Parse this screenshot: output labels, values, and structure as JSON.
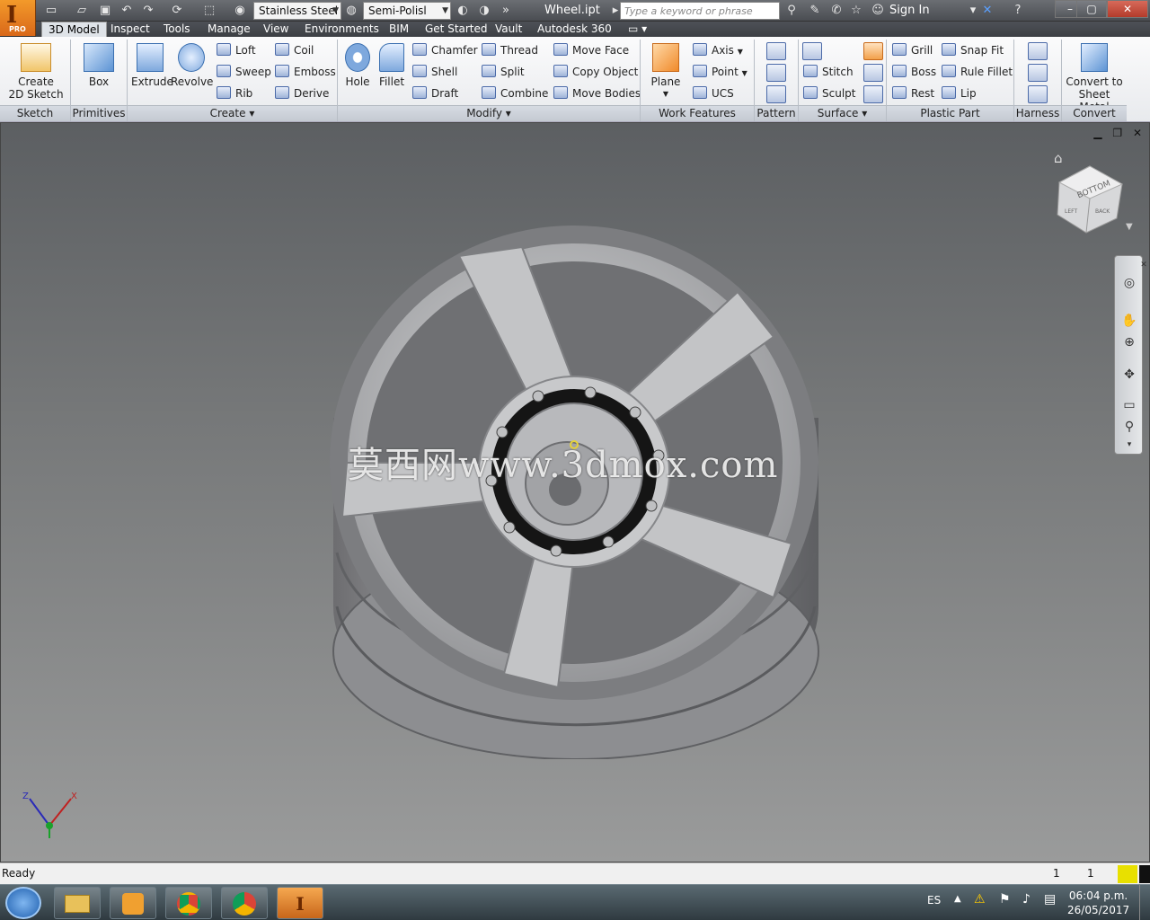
{
  "app": {
    "logo_letter": "I",
    "logo_sub": "PRO",
    "document_title": "Wheel.ipt"
  },
  "quick_access": {
    "material": "Stainless Steel",
    "appearance": "Semi-Polisl",
    "search_placeholder": "Type a keyword or phrase",
    "sign_in": "Sign In"
  },
  "tabs": [
    "3D Model",
    "Inspect",
    "Tools",
    "Manage",
    "View",
    "Environments",
    "BIM",
    "Get Started",
    "Vault",
    "Autodesk 360"
  ],
  "ribbon": {
    "sketch": {
      "button": "Create",
      "button2": "2D Sketch",
      "panel": "Sketch"
    },
    "primitives": {
      "button": "Box",
      "panel": "Primitives"
    },
    "create": {
      "extrude": "Extrude",
      "revolve": "Revolve",
      "loft": "Loft",
      "sweep": "Sweep",
      "rib": "Rib",
      "coil": "Coil",
      "emboss": "Emboss",
      "derive": "Derive",
      "panel": "Create"
    },
    "modify": {
      "hole": "Hole",
      "fillet": "Fillet",
      "chamfer": "Chamfer",
      "shell": "Shell",
      "draft": "Draft",
      "thread": "Thread",
      "split": "Split",
      "combine": "Combine",
      "move_face": "Move Face",
      "copy_object": "Copy Object",
      "move_bodies": "Move Bodies",
      "panel": "Modify"
    },
    "work_features": {
      "plane": "Plane",
      "axis": "Axis",
      "point": "Point",
      "ucs": "UCS",
      "panel": "Work Features"
    },
    "pattern": {
      "panel": "Pattern"
    },
    "surface": {
      "stitch": "Stitch",
      "sculpt": "Sculpt",
      "panel": "Surface"
    },
    "plastic_part": {
      "grill": "Grill",
      "boss": "Boss",
      "rest": "Rest",
      "snap_fit": "Snap Fit",
      "rule_fillet": "Rule Fillet",
      "lip": "Lip",
      "panel": "Plastic Part"
    },
    "harness": {
      "panel": "Harness"
    },
    "convert": {
      "button": "Convert to",
      "button2": "Sheet Metal",
      "panel": "Convert"
    }
  },
  "viewport": {
    "watermark": "莫西网www.3dmox.com",
    "viewcube_top": "BOTTOM",
    "viewcube_left": "LEFT",
    "viewcube_right": "BACK"
  },
  "status": {
    "text": "Ready",
    "count1": "1",
    "count2": "1"
  },
  "taskbar": {
    "lang": "ES",
    "time": "06:04 p.m.",
    "date": "26/05/2017"
  }
}
